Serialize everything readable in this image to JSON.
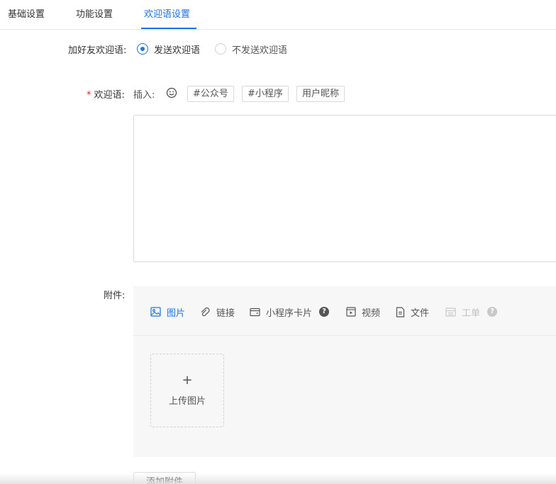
{
  "tabs": [
    {
      "label": "基础设置"
    },
    {
      "label": "功能设置"
    },
    {
      "label": "欢迎语设置"
    }
  ],
  "form": {
    "welcome_toggle_label": "加好友欢迎语:",
    "radio_send": "发送欢迎语",
    "radio_no_send": "不发送欢迎语",
    "required_mark": "*",
    "welcome_label": "欢迎语:",
    "insert_label": "插入:",
    "insert_tags": [
      "#公众号",
      "#小程序",
      "用户昵称"
    ],
    "textarea_value": "",
    "attachments_label": "附件:"
  },
  "attachments": {
    "types": [
      {
        "label": "图片",
        "icon": "image-icon"
      },
      {
        "label": "链接",
        "icon": "link-icon"
      },
      {
        "label": "小程序卡片",
        "icon": "mini-program-card-icon"
      },
      {
        "label": "视频",
        "icon": "video-icon"
      },
      {
        "label": "文件",
        "icon": "file-icon"
      },
      {
        "label": "工单",
        "icon": "ticket-icon"
      }
    ],
    "help_glyph": "?",
    "upload_plus": "+",
    "upload_label": "上传图片",
    "add_button": "添加附件"
  },
  "colors": {
    "accent": "#1a73e8",
    "required": "#e02020",
    "disabled": "#c0c0c0"
  }
}
